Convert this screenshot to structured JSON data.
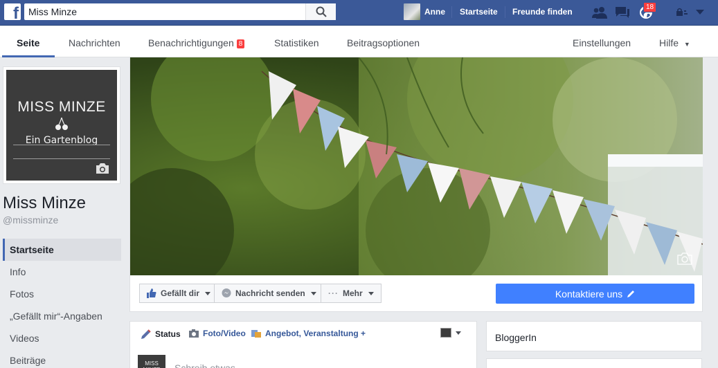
{
  "topbar": {
    "logo": "f",
    "search_value": "Miss Minze",
    "search_icon": "search-icon",
    "profile_name": "Anne",
    "home_label": "Startseite",
    "find_friends_label": "Freunde finden",
    "notifications_count": "18"
  },
  "pagenav": {
    "tabs": [
      {
        "label": "Seite"
      },
      {
        "label": "Nachrichten"
      },
      {
        "label": "Benachrichtigungen",
        "badge": "8"
      },
      {
        "label": "Statistiken"
      },
      {
        "label": "Beitragsoptionen"
      }
    ],
    "settings_label": "Einstellungen",
    "help_label": "Hilfe",
    "help_caret": "▼"
  },
  "profile": {
    "logo_title": "MISS MINZE",
    "logo_subtitle": "Ein Gartenblog",
    "name": "Miss Minze",
    "handle": "@missminze"
  },
  "sidenav": {
    "items": [
      {
        "label": "Startseite"
      },
      {
        "label": "Info"
      },
      {
        "label": "Fotos"
      },
      {
        "label": "„Gefällt mir“-Angaben"
      },
      {
        "label": "Videos"
      },
      {
        "label": "Beiträge"
      }
    ]
  },
  "actions": {
    "like_label": "Gefällt dir",
    "message_label": "Nachricht senden",
    "more_dots": "···",
    "more_label": "Mehr",
    "contact_label": "Kontaktiere uns"
  },
  "composer": {
    "status_label": "Status",
    "photo_label": "Foto/Video",
    "offer_label": "Angebot, Veranstaltung +",
    "avatar_text": "MISS MINZE",
    "placeholder": "Schreib etwas..."
  },
  "right": {
    "category": "BloggerIn"
  },
  "colors": {
    "brand": "#3b5998",
    "accent": "#4267b2",
    "cta": "#4080ff",
    "badge": "#fa3e3e"
  }
}
